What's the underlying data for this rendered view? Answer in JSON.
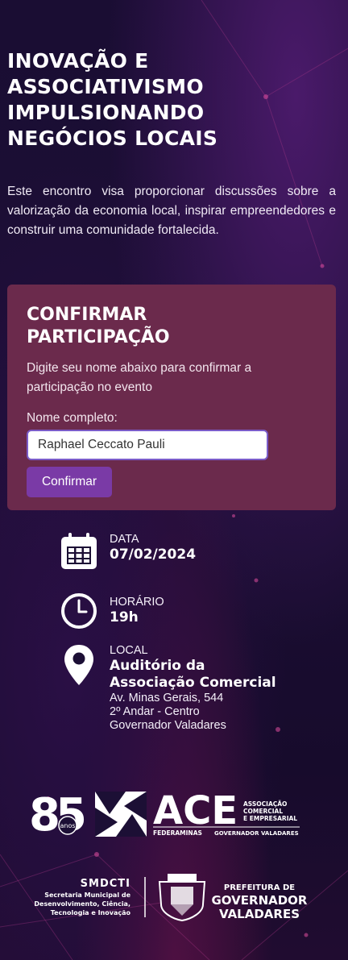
{
  "hero": {
    "title": "INOVAÇÃO E\nASSOCIATIVISMO\nIMPULSIONANDO\nNEGÓCIOS LOCAIS",
    "description": "Este encontro visa proporcionar discussões sobre a valorização da economia local, inspirar empreendedores e construir uma comunidade fortalecida."
  },
  "form": {
    "title": "CONFIRMAR\nPARTICIPAÇÃO",
    "subtitle": "Digite seu nome abaixo para confirmar a participação no evento",
    "name_label": "Nome completo:",
    "name_value": "Raphael Ceccato Pauli",
    "confirm_label": "Confirmar"
  },
  "event": {
    "date_label": "DATA",
    "date_value": "07/02/2024",
    "time_label": "HORÁRIO",
    "time_value": "19h",
    "location_label": "LOCAL",
    "location_line1": "Auditório da",
    "location_line2": "Associação Comercial",
    "address_line1": "Av. Minas Gerais, 544",
    "address_line2": "2º Andar - Centro",
    "address_line3": "Governador Valadares"
  },
  "logos": {
    "anniversary_number": "85",
    "anniversary_word": "anos",
    "ace": "ACE",
    "ace_line1": "ASSOCIAÇÃO",
    "ace_line2": "COMERCIAL",
    "ace_line3": "E EMPRESARIAL",
    "ace_federa": "FEDERAMINAS",
    "ace_city": "GOVERNADOR VALADARES",
    "smdcti": "SMDCTI",
    "smdcti_line1": "Secretaria Municipal de",
    "smdcti_line2": "Desenvolvimento, Ciência,",
    "smdcti_line3": "Tecnologia e Inovação",
    "prefeitura_line1": "PREFEITURA DE",
    "prefeitura_line2": "GOVERNADOR",
    "prefeitura_line3": "VALADARES"
  },
  "icons": {
    "date": "calendar-icon",
    "time": "clock-icon",
    "location": "map-pin-icon"
  },
  "colors": {
    "card_bg": "#6b2a4c",
    "button_bg": "#7a3aa6",
    "input_border": "#7b5cc9"
  }
}
